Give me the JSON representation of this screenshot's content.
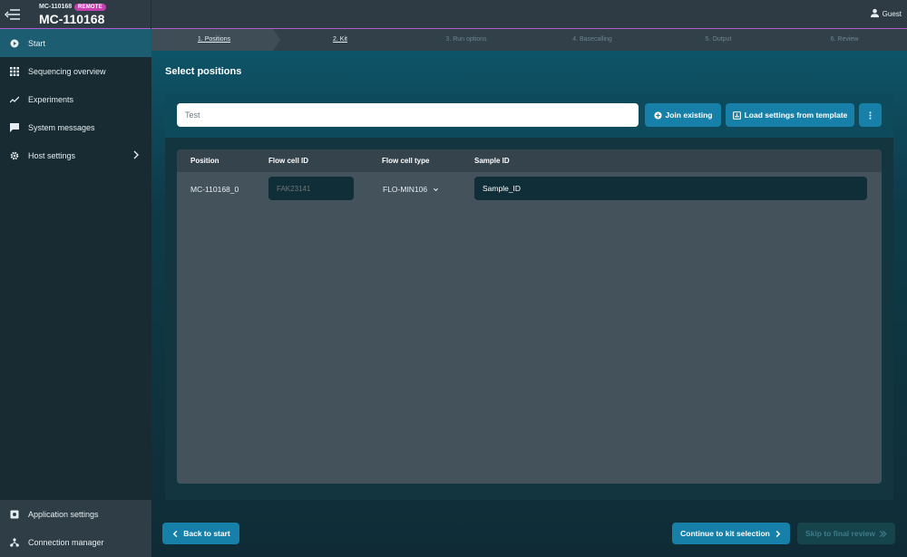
{
  "header": {
    "host_small": "MC-110168",
    "badge": "REMOTE",
    "host_large": "MC-110168",
    "user": "Guest"
  },
  "sidebar": {
    "items": [
      {
        "label": "Start",
        "icon": "play-circle-icon",
        "active": true
      },
      {
        "label": "Sequencing overview",
        "icon": "grid-icon"
      },
      {
        "label": "Experiments",
        "icon": "trend-line-icon"
      },
      {
        "label": "System messages",
        "icon": "chat-icon"
      },
      {
        "label": "Host settings",
        "icon": "gear-icon"
      }
    ],
    "bottom_items": [
      {
        "label": "Application settings",
        "icon": "settings-box-icon"
      },
      {
        "label": "Connection manager",
        "icon": "network-icon"
      }
    ]
  },
  "stepper": {
    "steps": [
      "1. Positions",
      "2. Kit",
      "3. Run options",
      "4. Basecalling",
      "5. Output",
      "6. Review"
    ]
  },
  "main": {
    "title": "Select positions",
    "experiment_name": "Test",
    "join_label": "Join existing",
    "load_label": "Load settings from template",
    "table": {
      "headers": [
        "Position",
        "Flow cell ID",
        "Flow cell type",
        "Sample ID"
      ],
      "rows": [
        {
          "position": "MC-110168_0",
          "flow_cell_id_placeholder": "FAK23141",
          "flow_cell_type": "FLO-MIN106",
          "sample_id": "Sample_ID"
        }
      ]
    }
  },
  "footer": {
    "back_label": "Back to start",
    "continue_label": "Continue to kit selection",
    "skip_label": "Skip to final review"
  },
  "colors": {
    "accent": "#1780a8",
    "badge": "#c63fae",
    "sidebar_active": "#1d5d72"
  }
}
